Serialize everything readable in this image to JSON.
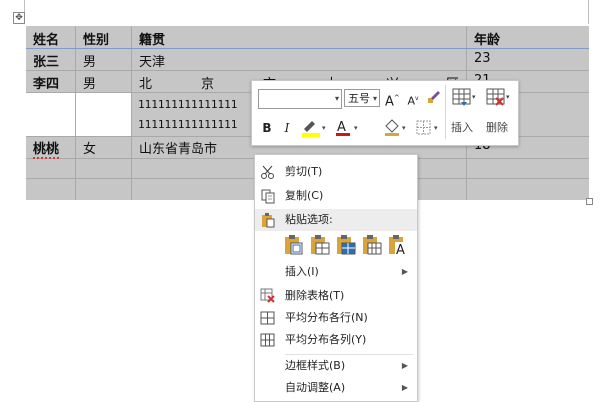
{
  "table": {
    "headers": [
      "姓名",
      "性别",
      "籍贯",
      "年龄"
    ],
    "rows": [
      {
        "name": "张三",
        "gender": "男",
        "origin": "天津",
        "age": "23"
      },
      {
        "name": "李四",
        "gender": "男",
        "origin_chars": [
          "北",
          "京",
          "市",
          "大",
          "兴",
          "区"
        ],
        "age": "21"
      },
      {
        "origin_line1": "111111111111111",
        "origin_line2": "111111111111111"
      },
      {
        "name": "桃桃",
        "gender": "女",
        "origin": "山东省青岛市",
        "age": "18"
      }
    ]
  },
  "mini_toolbar": {
    "font_name": "",
    "font_size": "五号",
    "grow_label": "A",
    "shrink_label": "A",
    "bold": "B",
    "italic": "I",
    "font_color_label": "A",
    "insert_label": "插入",
    "delete_label": "删除"
  },
  "context_menu": {
    "cut": "剪切(T)",
    "copy": "复制(C)",
    "paste_options": "粘贴选项:",
    "insert": "插入(I)",
    "delete_table": "删除表格(T)",
    "distribute_rows": "平均分布各行(N)",
    "distribute_cols": "平均分布各列(Y)",
    "border_styles": "边框样式(B)",
    "autofit": "自动调整(A)",
    "paste_opt_text_label": "A"
  },
  "colors": {
    "table_selection": "#c6c6c6",
    "highlight_yellow": "#ffff00",
    "font_red": "#d11414",
    "delete_red": "#d32f2f",
    "icon_blue": "#2e6fb3",
    "paste_gold": "#d9a43a"
  },
  "icons": [
    "table-move-icon",
    "font-dropdown-icon",
    "grow-font-icon",
    "shrink-font-icon",
    "format-painter-icon",
    "insert-table-icon",
    "delete-table-icon",
    "bold-icon",
    "italic-icon",
    "highlight-icon",
    "font-color-icon",
    "shading-icon",
    "borders-icon",
    "scissors-icon",
    "copy-icon",
    "paste-icon",
    "delete-table-menu-icon",
    "distribute-rows-icon",
    "distribute-cols-icon"
  ]
}
